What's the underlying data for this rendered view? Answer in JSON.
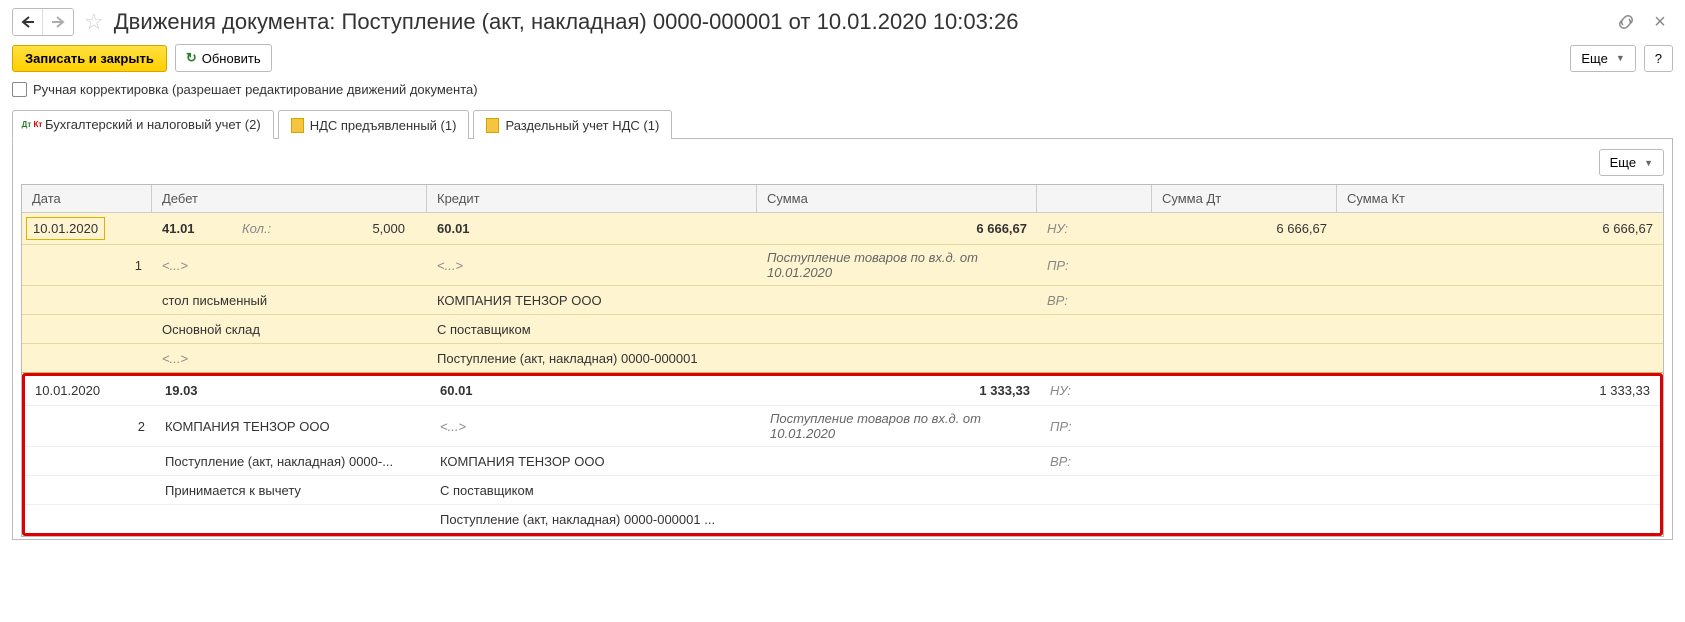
{
  "header": {
    "title": "Движения документа: Поступление (акт, накладная) 0000-000001 от 10.01.2020 10:03:26"
  },
  "toolbar": {
    "save_close": "Записать и закрыть",
    "refresh": "Обновить",
    "more": "Еще",
    "help": "?"
  },
  "checkbox": {
    "label": "Ручная корректировка (разрешает редактирование движений документа)"
  },
  "tabs": [
    {
      "label": "Бухгалтерский и налоговый учет (2)"
    },
    {
      "label": "НДС предъявленный (1)"
    },
    {
      "label": "Раздельный учет НДС (1)"
    }
  ],
  "inner_toolbar": {
    "more": "Еще"
  },
  "grid": {
    "headers": {
      "date": "Дата",
      "debit": "Дебет",
      "credit": "Кредит",
      "sum": "Сумма",
      "sumdt": "Сумма Дт",
      "sumkt": "Сумма Кт"
    },
    "entries": [
      {
        "date": "10.01.2020",
        "num": "1",
        "debit_acc": "41.01",
        "kol_label": "Кол.:",
        "kol_val": "5,000",
        "credit_acc": "60.01",
        "sum": "6 666,67",
        "sum_desc": "Поступление товаров по вх.д.  от 10.01.2020",
        "nu": "НУ:",
        "pr": "ПР:",
        "vr": "ВР:",
        "sumdt": "6 666,67",
        "sumkt": "6 666,67",
        "d_sub1": "<...>",
        "c_sub1": "<...>",
        "d_sub2": "стол письменный",
        "c_sub2": "КОМПАНИЯ ТЕНЗОР ООО",
        "d_sub3": "Основной склад",
        "c_sub3": "С поставщиком",
        "d_sub4": "<...>",
        "c_sub4": "Поступление (акт, накладная) 0000-000001"
      },
      {
        "date": "10.01.2020",
        "num": "2",
        "debit_acc": "19.03",
        "credit_acc": "60.01",
        "sum": "1 333,33",
        "sum_desc": "Поступление товаров по вх.д.  от 10.01.2020",
        "nu": "НУ:",
        "pr": "ПР:",
        "vr": "ВР:",
        "sumdt": "",
        "sumkt": "1 333,33",
        "d_sub1": "КОМПАНИЯ ТЕНЗОР ООО",
        "c_sub1": "<...>",
        "d_sub2": "Поступление (акт, накладная) 0000-...",
        "c_sub2": "КОМПАНИЯ ТЕНЗОР ООО",
        "d_sub3": "Принимается к вычету",
        "c_sub3": "С поставщиком",
        "c_sub4": "Поступление (акт, накладная) 0000-000001 ..."
      }
    ]
  }
}
